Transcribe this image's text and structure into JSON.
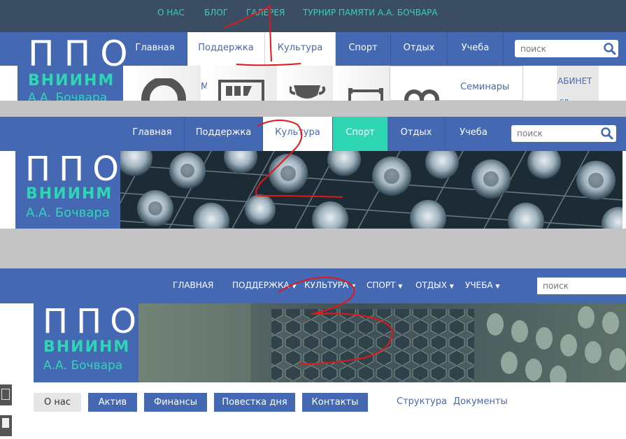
{
  "v1": {
    "top_links": [
      "О НАС",
      "БЛОГ",
      "ГАЛЕРЕЯ",
      "ТУРНИР ПАМЯТИ А.А. БОЧВАРА"
    ],
    "tabs": [
      "Главная",
      "Поддержка",
      "Культура",
      "Спорт",
      "Отдых",
      "Учеба"
    ],
    "search_placeholder": "поиск",
    "logo": {
      "ppo": "ППО",
      "vniinm": "ВНИИНМ",
      "bochvar": "А.А. Бочвара"
    },
    "dropdown": {
      "seminar": "Семинары",
      "kabinet": "АБИНЕТ",
      "kabinet2": "сл",
      "letter_m": "М"
    }
  },
  "v2": {
    "tabs": [
      "Главная",
      "Поддержка",
      "Культура",
      "Спорт",
      "Отдых",
      "Учеба"
    ],
    "search_placeholder": "поиск",
    "logo": {
      "ppo": "ППО",
      "vniinm": "ВНИИНМ",
      "bochvar": "А.А. Бочвара"
    }
  },
  "v3": {
    "nav": [
      "ГЛАВНАЯ",
      "ПОДДЕРЖКА",
      "КУЛЬТУРА",
      "СПОРТ",
      "ОТДЫХ",
      "УЧЕБА"
    ],
    "search_placeholder": "поиск",
    "logo": {
      "ppo": "ППО",
      "vniinm": "ВНИИНМ",
      "bochvar": "А.А. Бочвара"
    },
    "buttons": [
      "О нас",
      "Актив",
      "Финансы",
      "Повестка дня",
      "Контакты"
    ],
    "links": [
      "Структура",
      "Документы"
    ]
  },
  "annotations": [
    "1",
    "2",
    "3"
  ],
  "colors": {
    "brand_blue": "#4568b3",
    "teal": "#2fd6b4",
    "topbar": "#3a4d62",
    "annotation_red": "#e01818"
  }
}
